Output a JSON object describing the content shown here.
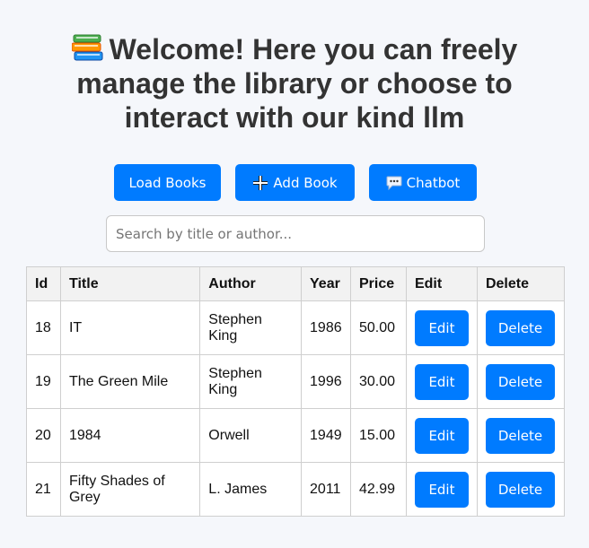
{
  "header": {
    "title": "Welcome! Here you can freely manage the library or choose to interact with our kind llm",
    "icon": "books-icon"
  },
  "toolbar": {
    "load_label": "Load Books",
    "add_label": "Add Book",
    "add_icon": "plus-icon",
    "chat_label": "Chatbot",
    "chat_icon": "speech-bubble-icon",
    "button_color": "#007bff"
  },
  "search": {
    "placeholder": "Search by title or author...",
    "value": ""
  },
  "table": {
    "columns": [
      "Id",
      "Title",
      "Author",
      "Year",
      "Price",
      "Edit",
      "Delete"
    ],
    "rows": [
      {
        "id": "18",
        "title": "IT",
        "author": "Stephen King",
        "year": "1986",
        "price": "50.00",
        "edit": "Edit",
        "delete": "Delete"
      },
      {
        "id": "19",
        "title": "The Green Mile",
        "author": "Stephen King",
        "year": "1996",
        "price": "30.00",
        "edit": "Edit",
        "delete": "Delete"
      },
      {
        "id": "20",
        "title": "1984",
        "author": "Orwell",
        "year": "1949",
        "price": "15.00",
        "edit": "Edit",
        "delete": "Delete"
      },
      {
        "id": "21",
        "title": "Fifty Shades of Grey",
        "author": "L. James",
        "year": "2011",
        "price": "42.99",
        "edit": "Edit",
        "delete": "Delete"
      }
    ]
  }
}
